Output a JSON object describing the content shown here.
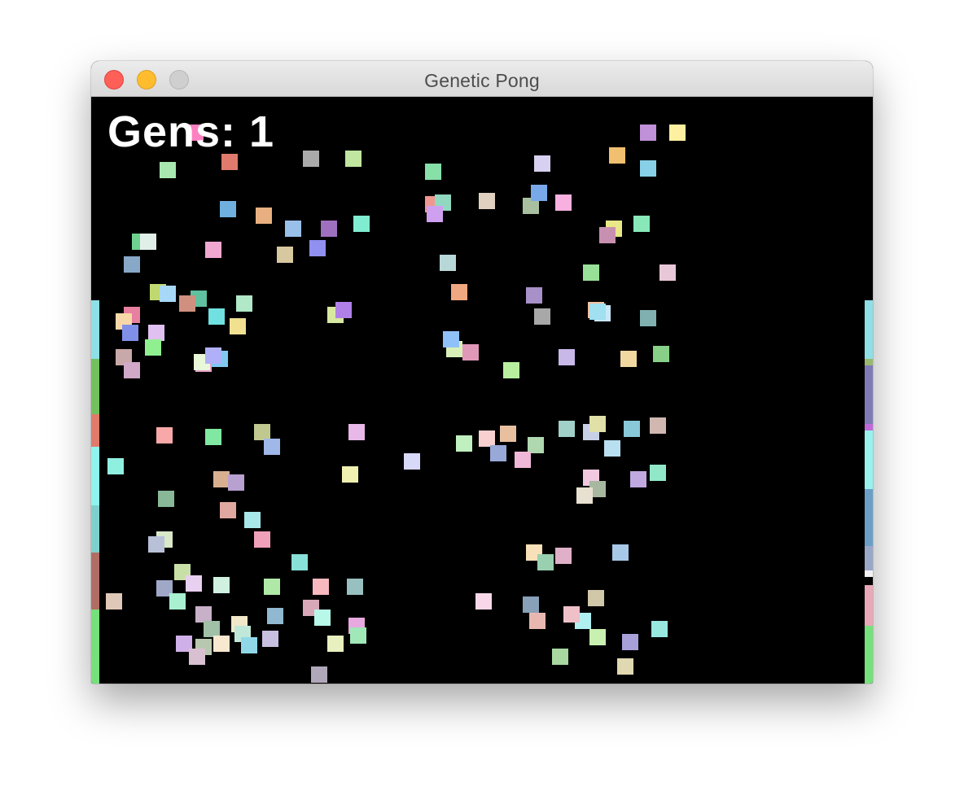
{
  "window": {
    "title": "Genetic Pong"
  },
  "hud": {
    "generations_label": "Gens: 1"
  },
  "colors": {
    "background": "#000000",
    "hud_text": "#ffffff",
    "traffic_close": "#fe5f57",
    "traffic_minimize": "#febc2e",
    "traffic_zoom": "#cfcfcf"
  },
  "paddles": {
    "left": [
      "#8fdfe6",
      "#72c05e",
      "#e07a6c",
      "#8ff3ee",
      "#7fd0cd",
      "#b06d64",
      "#76e07c"
    ],
    "right": [
      "#8fdfe6",
      "#9ab870",
      "#7f7ab5",
      "#c06ad8",
      "#99f2ee",
      "#6b9fc6",
      "#9aa8c8",
      "#f2f2f2",
      "#e8a8b8",
      "#76e07c"
    ]
  },
  "balls": [
    "#fe80c0",
    "#a8e8b0",
    "#e07a6c",
    "#aaaaaa",
    "#c0e6a0",
    "#87e0a8",
    "#d8d0f0",
    "#f0c070",
    "#88d0e8",
    "#fdf0a0",
    "#c090d8",
    "#70b0e0",
    "#e8b080",
    "#99c0ea",
    "#a070c0",
    "#80ecd0",
    "#f6a0a0",
    "#d8c8a0",
    "#9090f0",
    "#70d090",
    "#e0f0e8",
    "#f0a8d0",
    "#88a8c8",
    "#c0d870",
    "#e880a0",
    "#a8d8f8",
    "#60c0a0",
    "#d09080",
    "#b0e8c8",
    "#f8d8a8",
    "#8090e8",
    "#e0c0f0",
    "#70e0e0",
    "#f0e090",
    "#c8a8a8",
    "#90f090",
    "#a0a0e0",
    "#e8a0c8",
    "#80c8f0",
    "#d8e8a0",
    "#b080e8",
    "#f09890",
    "#90d8c0",
    "#e0d0c0",
    "#a8c0a0",
    "#f8b0e0",
    "#78a8e8",
    "#e8e888",
    "#c890b0",
    "#88e8b8",
    "#d0a0f0",
    "#b8d8d8",
    "#f0a880",
    "#a890c8",
    "#98e098",
    "#e8c8d8",
    "#80b0b0",
    "#c8e8f8",
    "#f8c0a0",
    "#a8a8a8",
    "#d8f0b8",
    "#90c0f8",
    "#e098b8",
    "#b8f0a0",
    "#c8b8e8",
    "#a0e0f0",
    "#f0d8a0",
    "#88d088",
    "#d0a8c8",
    "#e8f8d8",
    "#b0b0f8",
    "#f8a8a8",
    "#80e8a0",
    "#c0c890",
    "#a0b8e8",
    "#e8b8e8",
    "#90f0e0",
    "#d8b090",
    "#b8a0d0",
    "#f0f0b0",
    "#88b898",
    "#e0a8a0",
    "#a8e8e8",
    "#d8d8f8",
    "#c0f0c0",
    "#f8d0d0",
    "#98a8d8",
    "#e8c0a0",
    "#b0d8b0",
    "#f0b8d8",
    "#a0d0c8",
    "#c8d0e8",
    "#e0e0a8",
    "#88c8d8",
    "#d0b8b0",
    "#b8e0f0",
    "#f0c8e0",
    "#a8b8a0",
    "#e8e0d0",
    "#90e8c8",
    "#c0a8e0",
    "#f8e0b8",
    "#98d0b0",
    "#e0b0c8",
    "#a8c8e8",
    "#d8e8c8",
    "#b8c0d8",
    "#f0a0b8",
    "#88e0d8",
    "#c8e0a8",
    "#e8d0f0",
    "#a0a8c8",
    "#d0f0e0",
    "#b0e8a8",
    "#f8b8c0",
    "#98c0c0",
    "#e0c8b8",
    "#a8f0d0",
    "#c8b0c8",
    "#f0e8c8",
    "#90b8d0",
    "#d8a8b8",
    "#b8f8e8",
    "#e8a8e0",
    "#a0c0a8",
    "#c0e8d8",
    "#f8d8e8",
    "#88a0b8",
    "#d0c8a8",
    "#b0f0f0",
    "#e8b8b0",
    "#a8a0d8",
    "#c8f0b0",
    "#f0c0c8",
    "#98e8e0",
    "#e0d8b0",
    "#a8d8a0",
    "#d0b0e8",
    "#b8c8b0",
    "#f8e8d0",
    "#90d8e8",
    "#c8c0e0",
    "#e8f0c0",
    "#a0e8b8",
    "#d8c0d0",
    "#b0a8b8"
  ]
}
